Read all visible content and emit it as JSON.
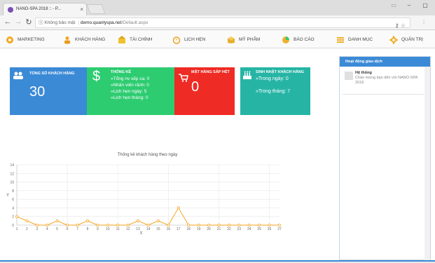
{
  "browser": {
    "tab_title": "NANO-SPA 2018 :: - P...",
    "tab_close": "×",
    "win_min": "–",
    "win_max": "▢",
    "win_close": "✕",
    "security": "Không bảo mật",
    "url_host": "demo.quanlyspa.net",
    "url_path": "/Default.aspx"
  },
  "nav": {
    "items": [
      {
        "label": "MARKETING",
        "icon": "marketing-icon",
        "color": "#f5a623"
      },
      {
        "label": "KHÁCH HÀNG",
        "icon": "customers-icon",
        "color": "#f5a623"
      },
      {
        "label": "TÀI CHÍNH",
        "icon": "finance-icon",
        "color": "#f0c030"
      },
      {
        "label": "LỊCH HẸN",
        "icon": "calendar-icon",
        "color": "#f0a020"
      },
      {
        "label": "MỸ PHẨM",
        "icon": "cosmetics-icon",
        "color": "#e6b030"
      },
      {
        "label": "BÁO CÁO",
        "icon": "report-icon",
        "color": "#f0b030"
      },
      {
        "label": "DANH MỤC",
        "icon": "category-icon",
        "color": "#f0b030"
      },
      {
        "label": "QUẢN TRỊ",
        "icon": "admin-icon",
        "color": "#f0b030"
      }
    ]
  },
  "stats": {
    "customers": {
      "title": "TỔNG SỐ KHÁCH HÀNG",
      "value": "30",
      "color": "#3b8ad6"
    },
    "stats": {
      "title": "THỐNG KÊ",
      "lines": [
        "»Tổng nv xếp ca: 0",
        "»Nhân viên rảnh: 0",
        "»Lịch hẹn ngày: 5",
        "»Lịch hẹn tháng: 0"
      ],
      "color": "#2ecc71"
    },
    "out_of_stock": {
      "title": "MẶT HÀNG SẮP HẾT",
      "value": "0",
      "color": "#ee2b24"
    },
    "birthday": {
      "title": "SINH NHẬT KHÁCH HÀNG",
      "day": "»Trong ngày: 0",
      "month": "»Trong tháng: 7",
      "color": "#26b5a5"
    }
  },
  "activity": {
    "header": "Hoạt động giao dịch",
    "items": [
      {
        "name": "Hệ thống",
        "message": "Chào mừng bạn đến với NANO-SPA 2018"
      }
    ]
  },
  "chart_data": {
    "type": "line",
    "title": "Thống kê khách hàng theo ngày",
    "xlabel": "X",
    "ylabel": "Y",
    "x": [
      1,
      2,
      3,
      4,
      5,
      6,
      7,
      8,
      9,
      10,
      11,
      12,
      13,
      14,
      15,
      16,
      17,
      18,
      19,
      20,
      21,
      22,
      23,
      24,
      25,
      26,
      27
    ],
    "values": [
      2,
      1,
      0,
      0,
      1,
      0,
      0,
      1,
      0,
      0,
      0,
      0,
      1,
      0,
      1,
      0,
      4,
      0,
      0,
      0,
      0,
      0,
      0,
      0,
      0,
      0,
      0
    ],
    "ylim": [
      0,
      14
    ],
    "yticks": [
      0,
      2,
      4,
      6,
      8,
      10,
      12,
      14
    ],
    "line_color": "#f5a623",
    "grid": true
  }
}
